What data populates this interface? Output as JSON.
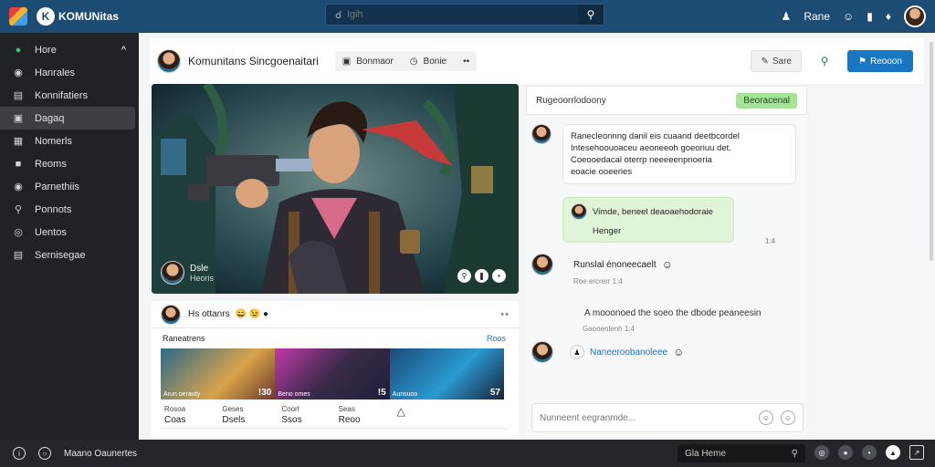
{
  "topbar": {
    "brand": "KOMUNitas",
    "search_placeholder": "lgih",
    "user_label": "Rane",
    "icons": [
      "user-icon",
      "smile-icon",
      "chart-icon",
      "notification-icon"
    ]
  },
  "sidebar": {
    "items": [
      {
        "label": "Hore",
        "icon": "leaf-icon",
        "active": false
      },
      {
        "label": "Hanrales",
        "icon": "chat-icon",
        "active": false
      },
      {
        "label": "Konnifatiers",
        "icon": "list-icon",
        "active": false
      },
      {
        "label": "Dagaq",
        "icon": "game-icon",
        "active": true
      },
      {
        "label": "Nomerls",
        "icon": "grid-icon",
        "active": false
      },
      {
        "label": "Reoms",
        "icon": "inbox-icon",
        "active": false
      },
      {
        "label": "Parnethiis",
        "icon": "pin-icon",
        "active": false
      },
      {
        "label": "Ponnots",
        "icon": "location-icon",
        "active": false
      },
      {
        "label": "Uentos",
        "icon": "globe-icon",
        "active": false
      },
      {
        "label": "Sernisegae",
        "icon": "settings-icon",
        "active": false
      }
    ]
  },
  "header": {
    "title": "Komunitans Sincgoenaitari",
    "tab1": "Bonmaor",
    "tab2": "Bonie",
    "btn_save": "Sare",
    "btn_primary": "Reooon"
  },
  "hero": {
    "name": "Dsle",
    "sub": "Heoris"
  },
  "card": {
    "name": "Hs ottanrs",
    "emojis": "😄 😉 ●",
    "section_label": "Raneatrens",
    "section_link": "Roos",
    "thumbs": [
      {
        "cap": "Arun oerauty",
        "num": "!30"
      },
      {
        "cap": "Beno omes",
        "num": "!5"
      },
      {
        "cap": "Aunsuoo",
        "num": "57"
      }
    ],
    "stats": [
      {
        "k": "Rosoa",
        "v": "Coas"
      },
      {
        "k": "Geses",
        "v": "Dsels"
      },
      {
        "k": "Coorl",
        "v": "Ssos"
      },
      {
        "k": "Seas",
        "v": "Reoo"
      }
    ]
  },
  "chat": {
    "title": "Rugeoorrlodoony",
    "tag": "Beoracenal",
    "msg1": [
      "Ranecleonnng danil eis cuaand deetbcordel",
      "Intesehoouoaceu aeoneeoh goeoriuu det.",
      "Coeooedacal oterrp neeeeenpnoeria",
      "eoacie ooeeries"
    ],
    "msg1_time": "",
    "msg2": "Vimde, beneel deaoaehodoraie",
    "msg2_sub": "Henger",
    "msg2_time": "1:4",
    "msg3": "Runslal énoneecaelt",
    "msg3_time": "Roe ercrerr 1:4",
    "sys": "A mooonoed the soeo the dbode peaneesin",
    "sys_time": "Gaooenlenh 1:4",
    "msg4": "Naneeroobanoleee",
    "placeholder": "Nunneent eegranmde...",
    "stamp_a": "1:4"
  },
  "bottombar": {
    "label": "Maano Oaunertes",
    "field": "Gla Heme"
  },
  "colors": {
    "topbar": "#1c4b73",
    "sidebar": "#1f2226",
    "primary": "#1976c0",
    "green_tag": "#a6e39a"
  }
}
